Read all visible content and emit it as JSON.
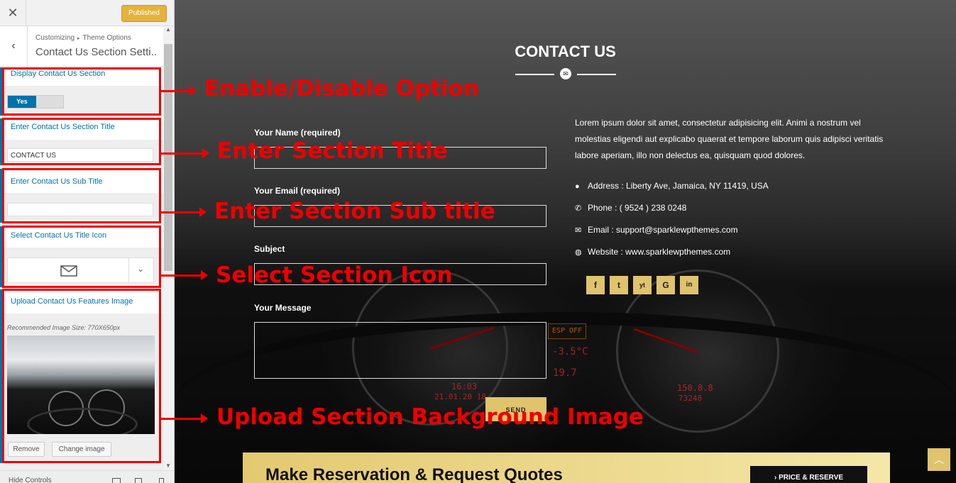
{
  "panel": {
    "close_icon": "close-icon",
    "publish_label": "Published",
    "breadcrumb_root": "Customizing",
    "breadcrumb_sep": "▸",
    "breadcrumb_parent": "Theme Options",
    "section_title": "Contact Us Section Setti...",
    "controls": {
      "display": {
        "label": "Display Contact Us Section",
        "toggle_yes": "Yes"
      },
      "title": {
        "label": "Enter Contact Us Section Title",
        "value": "CONTACT US"
      },
      "subtitle": {
        "label": "Enter Contact Us Sub Title",
        "value": ""
      },
      "icon": {
        "label": "Select Contact Us Title Icon",
        "selected_icon": "envelope-icon"
      },
      "image": {
        "label": "Upload Contact Us Features Image",
        "hint": "Recommended Image Size: 770X650px",
        "remove_label": "Remove",
        "change_label": "Change image"
      }
    },
    "footer_label": "Hide Controls"
  },
  "preview": {
    "title": "CONTACT US",
    "form": {
      "name_label": "Your Name (required)",
      "email_label": "Your Email (required)",
      "subject_label": "Subject",
      "message_label": "Your Message",
      "send_label": "SEND"
    },
    "description": "Lorem ipsum dolor sit amet, consectetur adipisicing elit. Animi a nostrum vel molestias eligendi aut explicabo quaerat et tempore laborum quis adipisci veritatis labore aperiam, illo non delectus ea, quisquam quod dolores.",
    "info": {
      "address": "Address : Liberty Ave, Jamaica, NY 11419, USA",
      "phone": "Phone : ( 9524 ) 238 0248",
      "email": "Email : support@sparklewpthemes.com",
      "website": "Website : www.sparklewpthemes.com"
    },
    "social": [
      "f",
      "t",
      "yt",
      "G",
      "in"
    ],
    "cta": {
      "text": "Make Reservation & Request Quotes",
      "button": "PRICE & RESERVE"
    },
    "dashboard_text": {
      "esp_off": "ESP OFF",
      "temp": "-3.5°C",
      "time": "16:03",
      "date": "21.01.20 18",
      "mileage": "150.8.8",
      "odometer": "73248",
      "fuel": "19.7"
    }
  },
  "annotations": {
    "enable": "Enable/Disable Option",
    "title": "Enter Section Title",
    "subtitle": "Enter Section Sub title",
    "icon": "Select Section Icon",
    "image": "Upload Section Background Image"
  },
  "colors": {
    "accent_blue": "#0073aa",
    "gold": "#dfc36d",
    "annotation_red": "#e00000"
  }
}
